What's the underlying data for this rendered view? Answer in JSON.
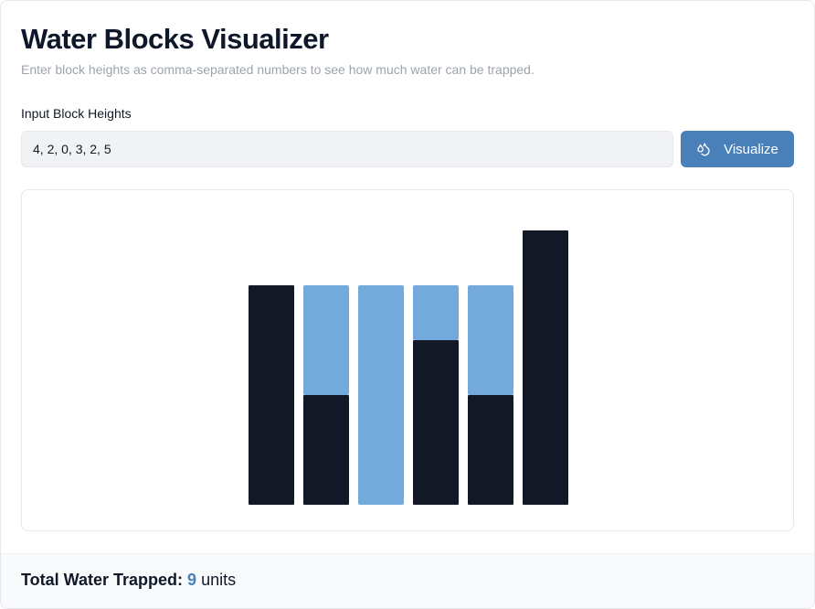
{
  "header": {
    "title": "Water Blocks Visualizer",
    "subtitle": "Enter block heights as comma-separated numbers to see how much water can be trapped."
  },
  "input": {
    "label": "Input Block Heights",
    "value": "4, 2, 0, 3, 2, 5"
  },
  "button": {
    "label": "Visualize",
    "icon": "droplets-icon",
    "color": "#4a80b9"
  },
  "visualization": {
    "heights": [
      4,
      2,
      0,
      3,
      2,
      5
    ],
    "water": [
      0,
      2,
      4,
      1,
      2,
      0
    ],
    "block_color": "#131827",
    "water_color": "#74a9dc"
  },
  "result": {
    "label": "Total Water Trapped:",
    "value": "9",
    "unit": "units"
  }
}
